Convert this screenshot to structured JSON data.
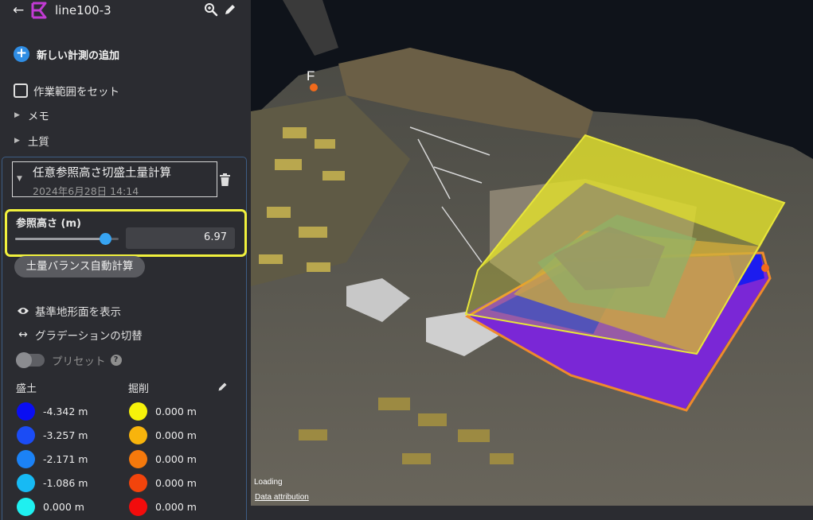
{
  "header": {
    "back_icon": "arrow-left-icon",
    "title": "line100-3",
    "logo_color": "#c23bd4",
    "search_icon": "search-zoom-icon",
    "edit_icon": "pencil-icon"
  },
  "add_measurement": {
    "label": "新しい計測の追加",
    "accent": "#2f8de4"
  },
  "work_area": {
    "label": "作業範囲をセット",
    "checked": false
  },
  "collapsibles": [
    {
      "label": "メモ"
    },
    {
      "label": "土質"
    }
  ],
  "calculation": {
    "title": "任意参照高さ切盛土量計算",
    "date": "2024年6月28日 14:14",
    "reference_height": {
      "label": "参照高さ (m)",
      "value": "6.97",
      "slider_fraction": 0.87,
      "highlight_color": "#f1f13d"
    },
    "auto_balance_button": "土量バランス自動計算",
    "options": {
      "show_base_surface": "基準地形面を表示",
      "toggle_gradation": "グラデーションの切替",
      "preset": "プリセット",
      "preset_enabled": false,
      "help_icon": "?"
    },
    "legend": {
      "fill_header": "盛土",
      "cut_header": "掘削",
      "fill": [
        {
          "value": "-4.342 m",
          "color": "#0a0ef2"
        },
        {
          "value": "-3.257 m",
          "color": "#1b4cf5"
        },
        {
          "value": "-2.171 m",
          "color": "#1b82f6"
        },
        {
          "value": "-1.086 m",
          "color": "#17baf4"
        },
        {
          "value": "0.000 m",
          "color": "#1ff0f0"
        }
      ],
      "cut": [
        {
          "value": "0.000 m",
          "color": "#f6f20a"
        },
        {
          "value": "0.000 m",
          "color": "#f8b40c"
        },
        {
          "value": "0.000 m",
          "color": "#f5790c"
        },
        {
          "value": "0.000 m",
          "color": "#f2440c"
        },
        {
          "value": "0.000 m",
          "color": "#f20c0c"
        }
      ]
    }
  },
  "map": {
    "point_label": "F",
    "status": "Loading",
    "attribution": "Data attribution"
  }
}
